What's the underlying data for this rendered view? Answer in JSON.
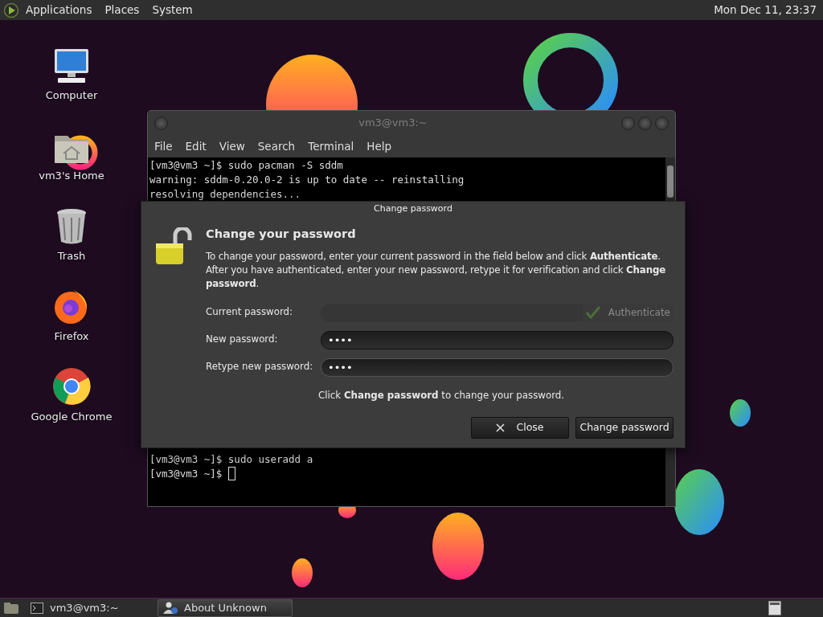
{
  "top_panel": {
    "menus": [
      "Applications",
      "Places",
      "System"
    ],
    "clock": "Mon Dec 11, 23:37"
  },
  "desktop_icons": [
    {
      "kind": "computer",
      "label": "Computer"
    },
    {
      "kind": "home",
      "label": "vm3's Home"
    },
    {
      "kind": "trash",
      "label": "Trash"
    },
    {
      "kind": "firefox",
      "label": "Firefox"
    },
    {
      "kind": "chrome",
      "label": "Google Chrome"
    }
  ],
  "terminal": {
    "title": "vm3@vm3:~",
    "menu": [
      "File",
      "Edit",
      "View",
      "Search",
      "Terminal",
      "Help"
    ],
    "lines_top": [
      "[vm3@vm3 ~]$ sudo pacman -S sddm",
      "warning: sddm-0.20.0-2 is up to date -- reinstalling",
      "resolving dependencies..."
    ],
    "lines_bottom": [
      "[vm3@vm3 ~]$ sudo useradd a",
      "[vm3@vm3 ~]$ "
    ]
  },
  "dialog": {
    "title": "Change password",
    "heading": "Change your password",
    "description": "To change your password, enter your current password in the field below and click **Authenticate**. After you have authenticated, enter your new password, retype it for verification and click **Change password**.",
    "fields": [
      {
        "label": "Current password:",
        "disabled": true,
        "button": {
          "label": "Authenticate",
          "disabled": true
        }
      },
      {
        "label": "New password:",
        "value": "••••",
        "disabled": false,
        "focused": false
      },
      {
        "label": "Retype new password:",
        "value": "••••",
        "disabled": false,
        "focused": true
      }
    ],
    "hint": "Click **Change password** to change your password.",
    "buttons": [
      {
        "kind": "close",
        "label": "Close"
      },
      {
        "kind": "confirm",
        "label": "Change password"
      }
    ]
  },
  "taskbar": {
    "tasks": [
      {
        "kind": "terminal",
        "label": "vm3@vm3:~",
        "selected": false
      },
      {
        "kind": "user",
        "label": "About Unknown",
        "selected": true
      }
    ]
  }
}
